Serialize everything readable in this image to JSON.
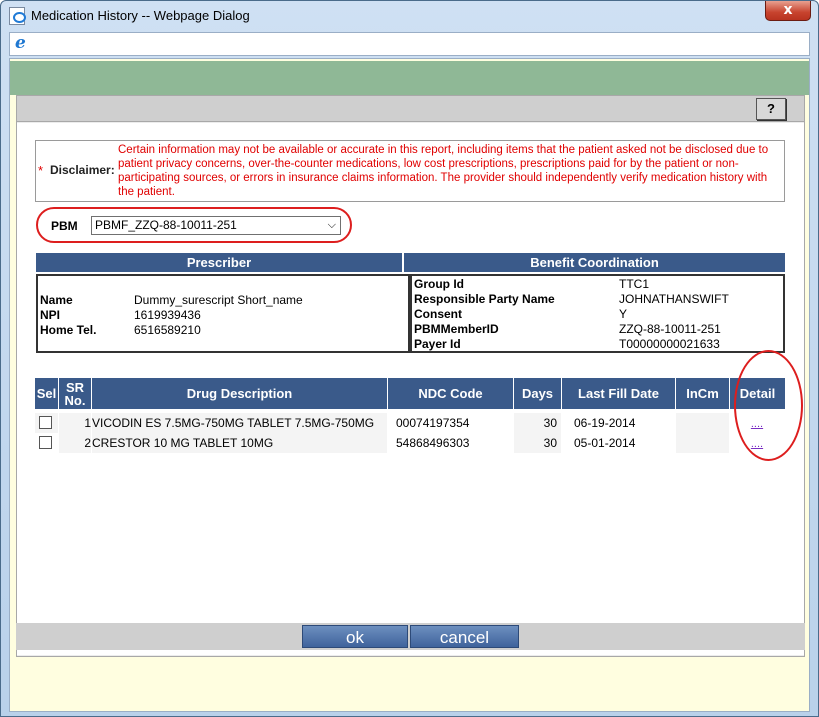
{
  "window": {
    "title": "Medication History -- Webpage Dialog",
    "close_glyph": "x"
  },
  "toolbar": {
    "help_label": "?"
  },
  "disclaimer": {
    "marker": "*",
    "label": "Disclaimer:",
    "text": "Certain information may not be available or accurate in this report, including items that the patient asked not be disclosed due to patient privacy concerns, over-the-counter medications, low cost prescriptions, prescriptions paid for by the patient or non-participating sources, or errors in insurance claims information. The provider should independently verify medication history with the patient."
  },
  "pbm": {
    "label": "PBM",
    "selected": "PBMF_ZZQ-88-10011-251"
  },
  "prescriber": {
    "header": "Prescriber",
    "name_label": "Name",
    "name_value": "Dummy_surescript Short_name",
    "npi_label": "NPI",
    "npi_value": "1619939436",
    "tel_label": "Home Tel.",
    "tel_value": "6516589210"
  },
  "benefit": {
    "header": "Benefit Coordination",
    "group_label": "Group Id",
    "group_value": "TTC1",
    "party_label": "Responsible Party Name",
    "party_value": "JOHNATHANSWIFT",
    "consent_label": "Consent",
    "consent_value": "Y",
    "member_label": "PBMMemberID",
    "member_value": "ZZQ-88-10011-251",
    "payer_label": "Payer Id",
    "payer_value": "T00000000021633"
  },
  "grid": {
    "headers": {
      "sel": "Sel",
      "sr": "SR No.",
      "drug": "Drug Description",
      "ndc": "NDC Code",
      "days": "Days",
      "last_fill": "Last Fill Date",
      "incm": "InCm",
      "detail": "Detail"
    },
    "rows": [
      {
        "sr": "1",
        "drug": "VICODIN ES 7.5MG-750MG TABLET 7.5MG-750MG",
        "ndc": "00074197354",
        "days": "30",
        "last_fill": "06-19-2014",
        "incm": "",
        "detail": "...."
      },
      {
        "sr": "2",
        "drug": "CRESTOR 10 MG TABLET 10MG",
        "ndc": "54868496303",
        "days": "30",
        "last_fill": "05-01-2014",
        "incm": "",
        "detail": "...."
      }
    ]
  },
  "footer": {
    "ok_label": "ok",
    "cancel_label": "cancel"
  },
  "icons": [
    "page-icon",
    "ie-icon",
    "close-icon",
    "chevron-down-icon"
  ],
  "colors": {
    "header_blue": "#3a5a8a",
    "green_band": "#8fb896",
    "dialog_bg": "#fffee0",
    "disclaimer_red": "#e00000",
    "annotation_red": "#dd1e1e"
  }
}
